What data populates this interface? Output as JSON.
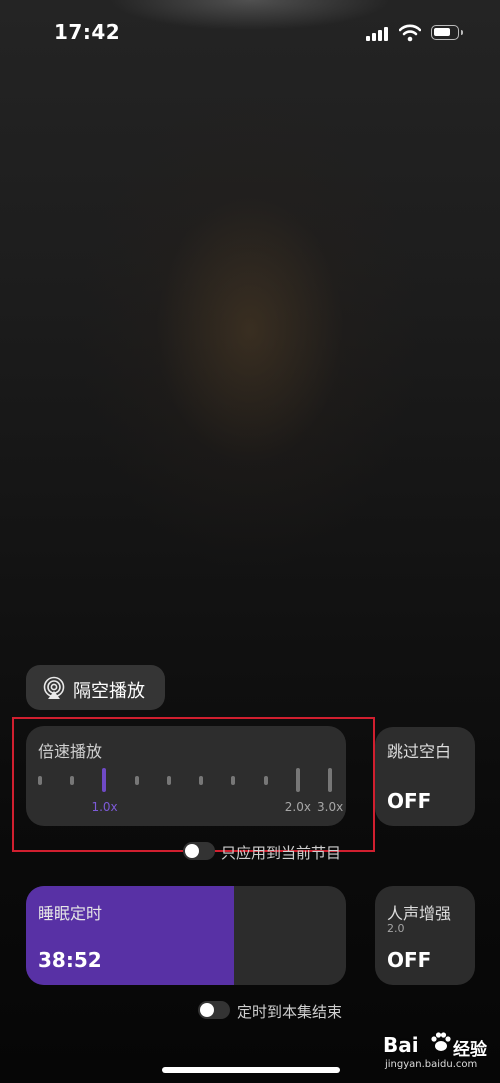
{
  "status_bar": {
    "time": "17:42",
    "battery_level": 0.75
  },
  "airplay": {
    "label": "隔空播放",
    "icon": "airplay-icon"
  },
  "speed": {
    "title": "倍速播放",
    "tick_count": 10,
    "selected_index": 2,
    "labels": [
      {
        "index": 2,
        "text": "1.0x"
      },
      {
        "index": 8,
        "text": "2.0x"
      },
      {
        "index": 9,
        "text": "3.0x"
      }
    ],
    "apply_toggle_label": "只应用到当前节目",
    "apply_toggle_on": false
  },
  "skip_silence": {
    "title": "跳过空白",
    "state": "OFF"
  },
  "sleep_timer": {
    "title": "睡眠定时",
    "remaining": "38:52",
    "progress": 0.65,
    "end_toggle_label": "定时到本集结束",
    "end_toggle_on": false
  },
  "voice_boost": {
    "title": "人声增强",
    "version": "2.0",
    "state": "OFF"
  },
  "watermark": {
    "brand": "Bai",
    "logo": "paw-icon",
    "sub": "经验",
    "url": "jingyan.baidu.com"
  },
  "colors": {
    "accent": "#6f4ac6",
    "sleep_fill": "#5831a5",
    "highlight_frame": "#d11f2f"
  }
}
